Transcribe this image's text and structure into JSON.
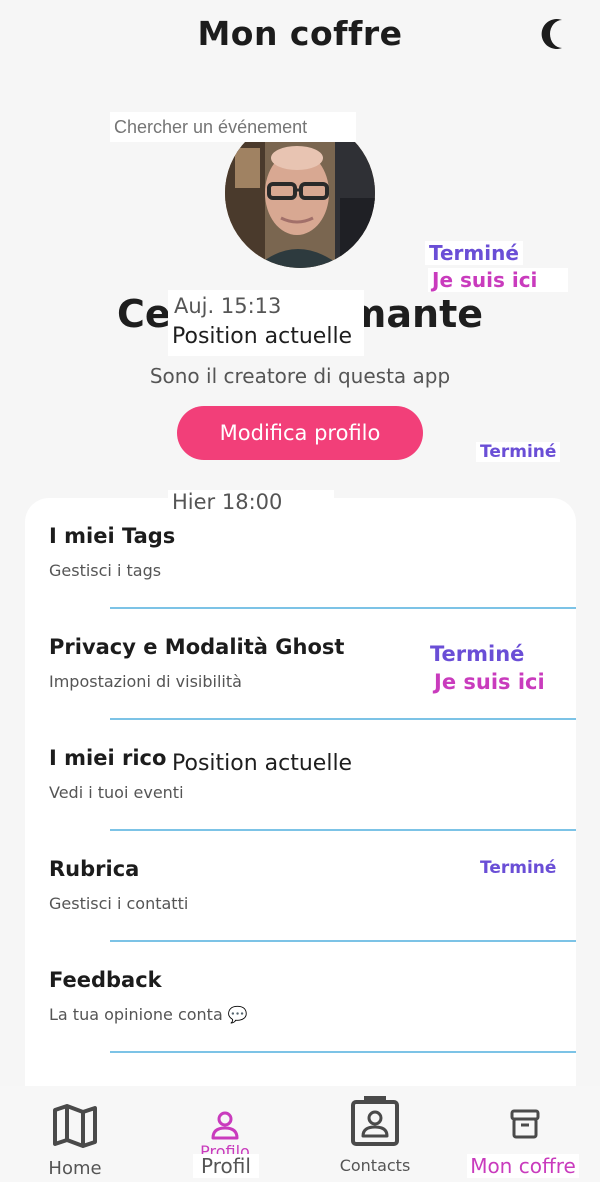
{
  "header": {
    "title": "Mon coffre"
  },
  "search": {
    "placeholder": "Chercher un événement"
  },
  "profile": {
    "name": "Cesare Diamante",
    "bio": "Sono il creatore di questa app",
    "edit_label": "Modifica profilo"
  },
  "overlays": {
    "time_today": "Auj. 15:13",
    "position_now": "Position actuelle",
    "time_yesterday": "Hier 18:00",
    "done": "Terminé",
    "here": "Je suis ici"
  },
  "menu": {
    "items": [
      {
        "title": "I miei Tags",
        "subtitle": "Gestisci i tags"
      },
      {
        "title": "Privacy e Modalità Ghost",
        "subtitle": "Impostazioni di visibilità"
      },
      {
        "title": "I miei rico",
        "subtitle": "Vedi i tuoi eventi"
      },
      {
        "title": "Rubrica",
        "subtitle": "Gestisci i contatti"
      },
      {
        "title": "Feedback",
        "subtitle": "La tua opinione conta 💬"
      }
    ]
  },
  "tabbar": {
    "home": "Home",
    "profile": "Profil",
    "profile_under": "Profilo",
    "contacts": "Contacts",
    "vault": "Mon coffre"
  },
  "colors": {
    "accent": "#f23f79",
    "purple": "#6a4ed6",
    "magenta": "#c93bbd",
    "divider": "#7cc3e6"
  },
  "icons": [
    "moon-icon",
    "map-icon",
    "user-icon",
    "contact-card-icon",
    "archive-icon"
  ]
}
